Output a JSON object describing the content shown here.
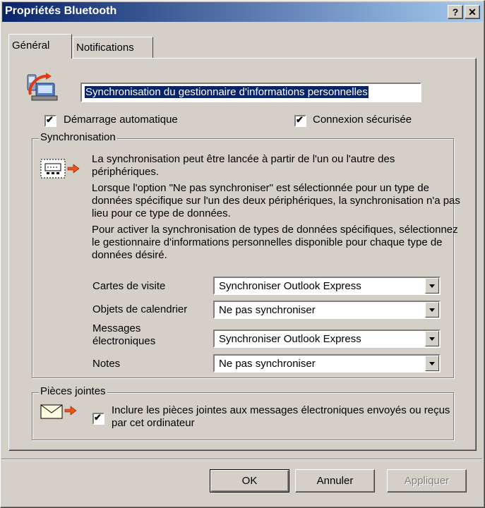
{
  "window": {
    "title": "Propriétés Bluetooth",
    "help_label": "?",
    "close_label": "✕"
  },
  "tabs": [
    {
      "label": "Général",
      "active": true
    },
    {
      "label": "Notifications",
      "active": false
    }
  ],
  "service_name": "Synchronisation du gestionnaire d'informations personnelles",
  "checkboxes": {
    "auto_start": {
      "label": "Démarrage automatique",
      "checked": true
    },
    "secure": {
      "label": "Connexion sécurisée",
      "checked": true
    }
  },
  "sync_group": {
    "title": "Synchronisation",
    "paragraphs": [
      "La synchronisation peut être lancée à partir de l'un ou l'autre des périphériques.",
      "Lorsque l'option \"Ne pas synchroniser\" est sélectionnée pour un type de données spécifique sur l'un des deux périphériques, la synchronisation n'a pas lieu pour ce type de données.",
      "Pour activer la synchronisation de types de données spécifiques, sélectionnez le gestionnaire d'informations personnelles disponible pour chaque type de données désiré."
    ],
    "rows": [
      {
        "label": "Cartes de visite",
        "value": "Synchroniser Outlook Express"
      },
      {
        "label": "Objets de calendrier",
        "value": "Ne pas synchroniser"
      },
      {
        "label": "Messages électroniques",
        "value": "Synchroniser Outlook Express"
      },
      {
        "label": "Notes",
        "value": "Ne pas synchroniser"
      }
    ]
  },
  "attach_group": {
    "title": "Pièces jointes",
    "checkbox_label": "Inclure les pièces jointes aux messages électroniques envoyés ou reçus par cet ordinateur",
    "checked": true
  },
  "buttons": {
    "ok": "OK",
    "cancel": "Annuler",
    "apply": "Appliquer"
  }
}
